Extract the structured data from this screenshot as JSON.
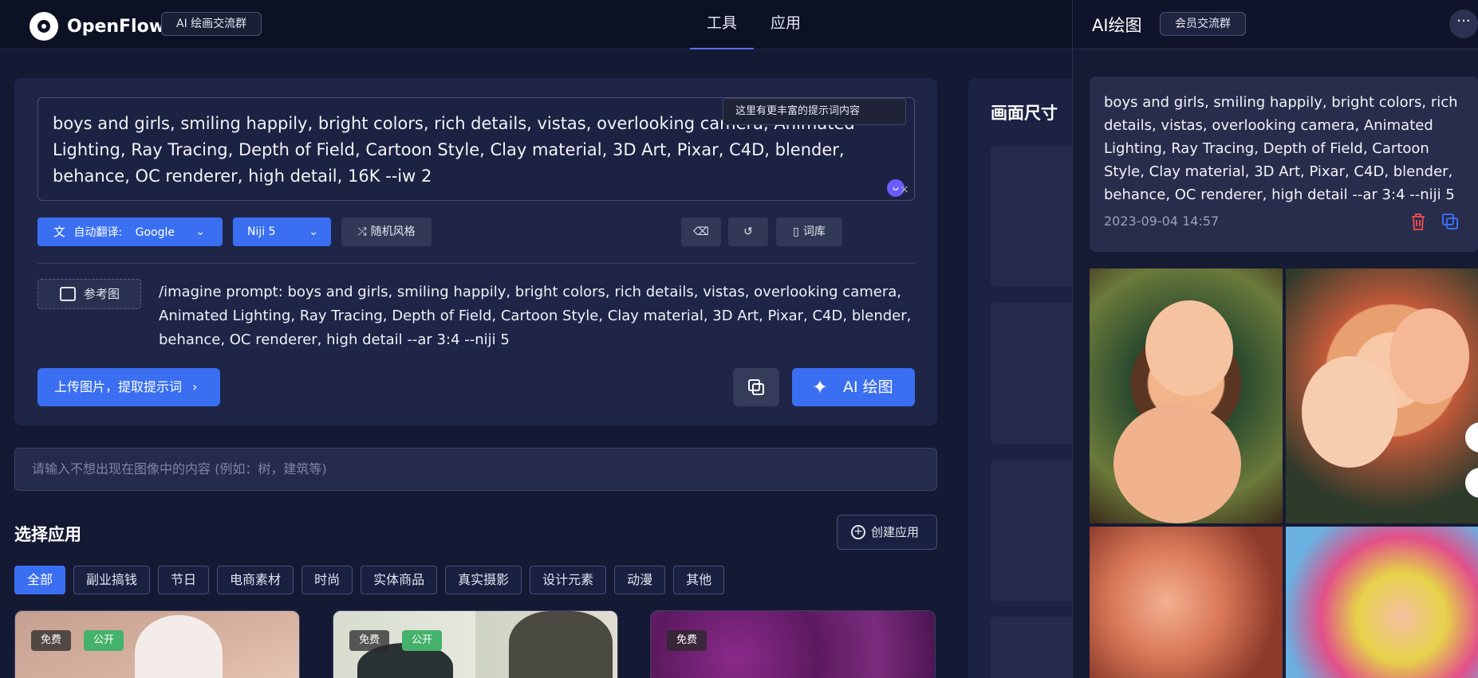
{
  "topbar": {
    "logo_text": "OpenFlow",
    "group_label": "AI 绘画交流群",
    "nav": [
      {
        "label": "工具",
        "active": true
      },
      {
        "label": "应用",
        "active": false
      }
    ]
  },
  "prompt": {
    "text": "boys and girls, smiling happily, bright colors, rich details, vistas, overlooking camera, Animated Lighting, Ray Tracing, Depth of Field, Cartoon Style, Clay material, 3D Art, Pixar, C4D, blender, behance, OC renderer, high detail, 16K  --iw 2",
    "tooltip": "这里有更丰富的提示词内容"
  },
  "toolbar": {
    "translate_label": "自动翻译:",
    "translate_engine": "Google",
    "model": "Niji 5",
    "random_style": "随机风格",
    "lexicon": "词库"
  },
  "reference": {
    "label": "参考图"
  },
  "imagine": {
    "text": "/imagine prompt:  boys and girls, smiling happily, bright colors, rich details, vistas, overlooking camera, Animated Lighting, Ray Tracing, Depth of Field, Cartoon Style, Clay material, 3D Art, Pixar, C4D, blender, behance, OC renderer, high detail --ar 3:4 --niji 5"
  },
  "actions": {
    "upload": "上传图片，提取提示词",
    "ai_draw": "AI 绘图"
  },
  "negative": {
    "placeholder": "请输入不想出现在图像中的内容 (例如：树，建筑等)"
  },
  "apps": {
    "title": "选择应用",
    "create": "创建应用",
    "tags": [
      "全部",
      "副业搞钱",
      "节日",
      "电商素材",
      "时尚",
      "实体商品",
      "真实摄影",
      "设计元素",
      "动漫",
      "其他"
    ],
    "cards": [
      {
        "badges": [
          "免费",
          "公开"
        ]
      },
      {
        "badges": [
          "免费",
          "公开"
        ]
      },
      {
        "badges": [
          "免费"
        ]
      }
    ]
  },
  "size_panel": {
    "title": "画面尺寸"
  },
  "drawer": {
    "title": "AI绘图",
    "group": "会员交流群",
    "message": "boys and girls, smiling happily, bright colors, rich details, vistas, overlooking camera, Animated Lighting, Ray Tracing, Depth of Field, Cartoon Style, Clay material, 3D Art, Pixar, C4D, blender, behance, OC renderer, high detail --ar 3:4 --niji 5",
    "time": "2023-09-04 14:57"
  },
  "colors": {
    "accent": "#3a6ff2",
    "badge_public": "#45b26b",
    "delete": "#e5484d"
  }
}
